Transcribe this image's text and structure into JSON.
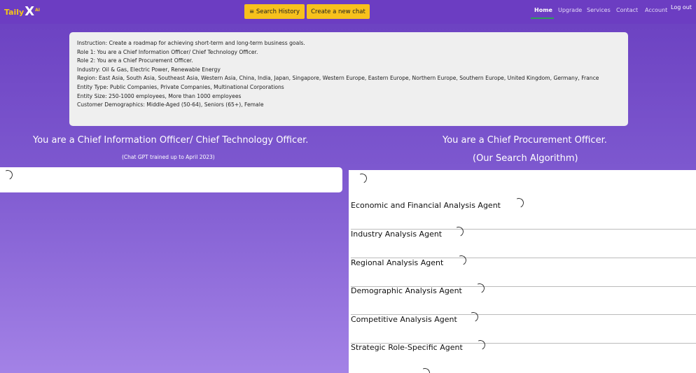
{
  "header": {
    "logo_text": "Taily",
    "logo_mark": "X",
    "logo_suffix": "AI",
    "search_history_label": "≡ Search History",
    "new_chat_label": "Create a new chat",
    "nav": [
      "Home",
      "Upgrade",
      "Services",
      "Contact",
      "Account"
    ],
    "active_nav": "Home",
    "logout_label": "Log out",
    "accent_color": "#f7c11c",
    "brand_color": "#6c3dc2"
  },
  "prompt": {
    "lines": [
      "Instruction: Create a roadmap for achieving short-term and long-term business goals.",
      "Role 1: You are a Chief Information Officer/ Chief Technology Officer.",
      "Role 2: You are a Chief Procurement Officer.",
      "Industry: Oil & Gas, Electric Power, Renewable Energy",
      "Region: East Asia, South Asia, Southeast Asia, Western Asia, China, India, Japan, Singapore, Western Europe, Eastern Europe, Northern Europe, Southern Europe, United Kingdom, Germany, France",
      "Entity Type: Public Companies, Private Companies, Multinational Corporations",
      "Entity Size: 250-1000 employees, More than 1000 employees",
      "Customer Demographics: Middle-Aged (50-64), Seniors (65+), Female"
    ]
  },
  "left": {
    "heading": "You are a Chief Information Officer/ Chief Technology Officer.",
    "note": "(Chat GPT trained up to April 2023)"
  },
  "right": {
    "heading": "You are a Chief Procurement Officer.",
    "subheading": "(Our Search Algorithm)",
    "agents": [
      "Economic and Financial Analysis Agent",
      "Industry Analysis Agent",
      "Regional Analysis Agent",
      "Demographic Analysis Agent",
      "Competitive Analysis Agent",
      "Strategic Role-Specific Agent"
    ]
  }
}
